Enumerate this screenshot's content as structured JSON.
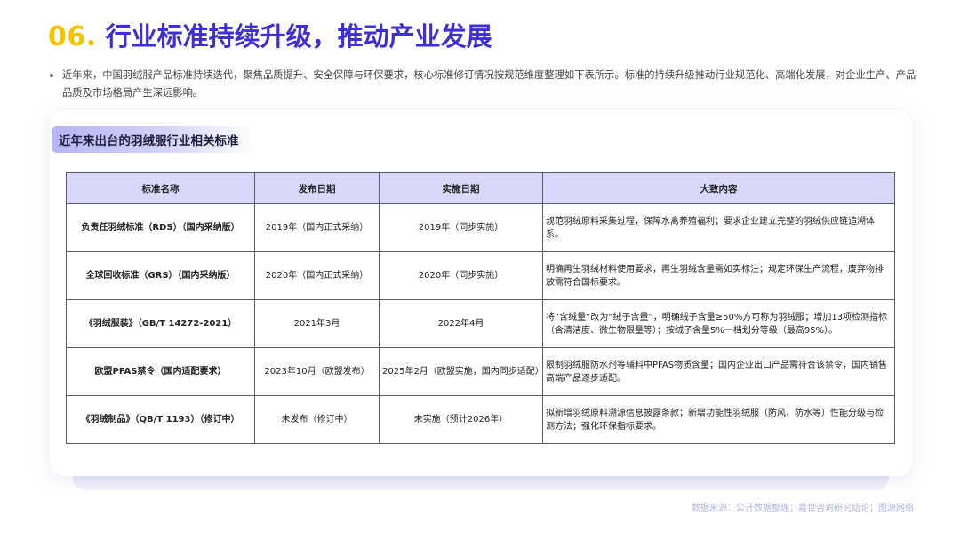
{
  "header": {
    "number": "06.",
    "title": "行业标准持续升级，推动产业发展"
  },
  "intro": "近年来，中国羽绒服产品标准持续迭代，聚焦品质提升、安全保障与环保要求，核心标准修订情况按规范维度整理如下表所示。标准的持续升级推动行业规范化、高端化发展，对企业生产、产品品质及市场格局产生深远影响。",
  "card": {
    "title": "近年来出台的羽绒服行业相关标准"
  },
  "table": {
    "headers": [
      "标准名称",
      "发布日期",
      "实施日期",
      "大致内容"
    ],
    "rows": [
      [
        "负责任羽绒标准（RDS）（国内采纳版）",
        "2019年（国内正式采纳）",
        "2019年（同步实施）",
        "规范羽绒原料采集过程，保障水禽养殖福利；要求企业建立完整的羽绒供应链追溯体系。"
      ],
      [
        "全球回收标准（GRS）（国内采纳版）",
        "2020年（国内正式采纳）",
        "2020年（同步实施）",
        "明确再生羽绒材料使用要求，再生羽绒含量需如实标注；规定环保生产流程，废弃物排放需符合国标要求。"
      ],
      [
        "《羽绒服装》（GB/T 14272-2021）",
        "2021年3月",
        "2022年4月",
        "将“含绒量”改为“绒子含量”，明确绒子含量≥50%方可称为羽绒服；增加13项检测指标（含清洁度、微生物限量等）；按绒子含量5%一档划分等级（最高95%）。"
      ],
      [
        "欧盟PFAS禁令（国内适配要求）",
        "2023年10月（欧盟发布）",
        "2025年2月（欧盟实施，国内同步适配）",
        "限制羽绒服防水剂等辅料中PFAS物质含量；国内企业出口产品需符合该禁令，国内销售高端产品逐步适配。"
      ],
      [
        "《羽绒制品》（QB/T 1193）（修订中）",
        "未发布（修订中）",
        "未实施（预计2026年）",
        "拟新增羽绒原料溯源信息披露条款；新增功能性羽绒服（防风、防水等）性能分级与检测方法；强化环保指标要求。"
      ]
    ]
  },
  "source": "数据来源：公开数据整理；嘉世咨询研究结论；图源网络",
  "colors": {
    "accent_yellow": "#f5c400",
    "title_purple": "#3e2fd4",
    "header_bg": "#d9d8fb"
  }
}
